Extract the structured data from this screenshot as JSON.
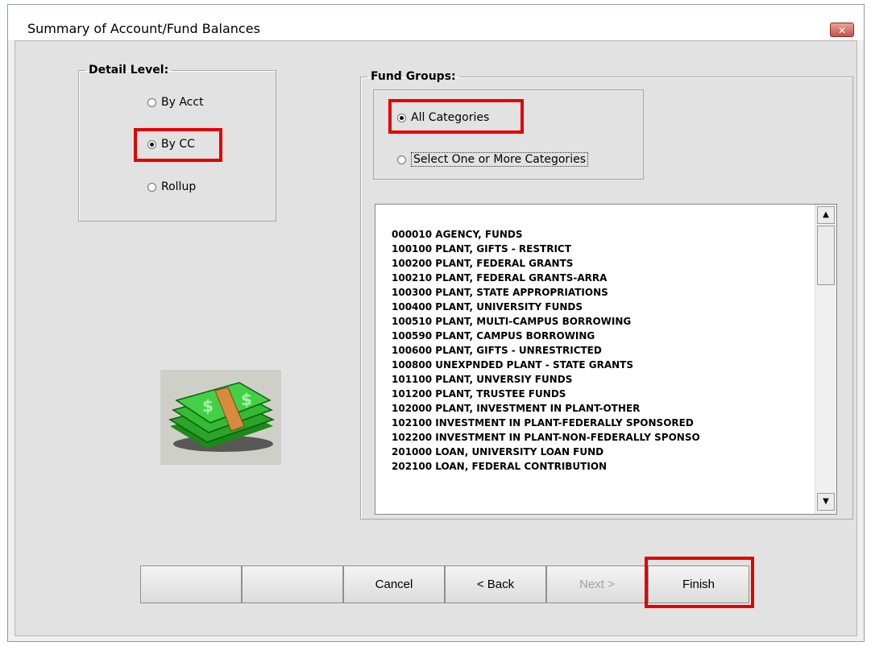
{
  "window": {
    "title": "Summary of Account/Fund Balances",
    "close_glyph": "✕"
  },
  "detail_level": {
    "legend": "Detail Level:",
    "options": [
      {
        "label": "By Acct",
        "selected": false
      },
      {
        "label": "By CC",
        "selected": true
      },
      {
        "label": "Rollup",
        "selected": false
      }
    ]
  },
  "fund_groups": {
    "legend": "Fund Groups:",
    "options": [
      {
        "label": "All Categories",
        "selected": true
      },
      {
        "label": "Select One or More Categories",
        "selected": false
      }
    ],
    "list": [
      "000010 AGENCY, FUNDS",
      "100100 PLANT, GIFTS - RESTRICT",
      "100200 PLANT, FEDERAL GRANTS",
      "100210 PLANT, FEDERAL GRANTS-ARRA",
      "100300 PLANT, STATE APPROPRIATIONS",
      "100400 PLANT, UNIVERSITY FUNDS",
      "100510 PLANT, MULTI-CAMPUS BORROWING",
      "100590 PLANT, CAMPUS BORROWING",
      "100600 PLANT, GIFTS - UNRESTRICTED",
      "100800 UNEXPNDED PLANT - STATE GRANTS",
      "101100 PLANT, UNVERSIY FUNDS",
      "101200 PLANT, TRUSTEE FUNDS",
      "102000 PLANT, INVESTMENT IN PLANT-OTHER",
      "102100 INVESTMENT IN PLANT-FEDERALLY SPONSORED",
      "102200 INVESTMENT IN PLANT-NON-FEDERALLY SPONSO",
      "201000 LOAN, UNIVERSITY LOAN FUND",
      "202100 LOAN, FEDERAL CONTRIBUTION"
    ],
    "scroll_up_glyph": "▲",
    "scroll_down_glyph": "▼"
  },
  "buttons": {
    "blank1": "",
    "blank2": "",
    "cancel": "Cancel",
    "back": "< Back",
    "next": "Next >",
    "finish": "Finish"
  },
  "icons": {
    "money": "money-stack-icon"
  },
  "colors": {
    "highlight": "#e30000",
    "money_green": "#2fc02f",
    "money_band": "#d88b3f"
  }
}
